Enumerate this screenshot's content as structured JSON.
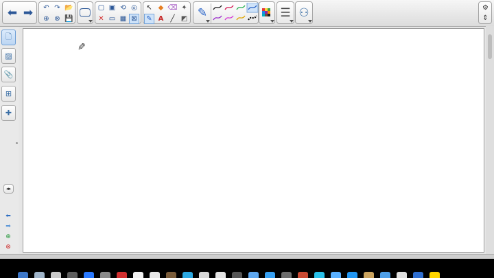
{
  "toolbar": {
    "nav": [
      {
        "name": "back-arrow-icon",
        "glyph": "⬅"
      },
      {
        "name": "forward-arrow-icon",
        "glyph": "➡"
      }
    ],
    "edit": [
      {
        "name": "undo-icon",
        "glyph": "↶"
      },
      {
        "name": "redo-icon",
        "glyph": "↷"
      },
      {
        "name": "open-folder-icon",
        "glyph": "📂"
      },
      {
        "name": "add-page-icon",
        "glyph": "⊕"
      },
      {
        "name": "delete-page-icon",
        "glyph": "⊗"
      },
      {
        "name": "save-icon",
        "glyph": "💾"
      }
    ],
    "screen": [
      {
        "name": "screen-shade-icon",
        "glyph": "🖵"
      }
    ],
    "insert": [
      {
        "name": "new-page-icon",
        "glyph": "▢"
      },
      {
        "name": "insert-picture-icon",
        "glyph": "▣"
      },
      {
        "name": "rotate-icon",
        "glyph": "⟲"
      },
      {
        "name": "screen-capture-icon",
        "glyph": "◎"
      },
      {
        "name": "delete-icon",
        "glyph": "✕"
      },
      {
        "name": "full-screen-icon",
        "glyph": "▭"
      },
      {
        "name": "table-icon",
        "glyph": "▦"
      },
      {
        "name": "document-camera-icon",
        "glyph": "⊠"
      }
    ],
    "tools": [
      {
        "name": "select-arrow-icon",
        "glyph": "↖"
      },
      {
        "name": "shapes-icon",
        "glyph": "◆"
      },
      {
        "name": "eraser-icon",
        "glyph": "⌫"
      },
      {
        "name": "magic-pen-icon",
        "glyph": "✦"
      },
      {
        "name": "creative-pen-icon",
        "glyph": "✎"
      },
      {
        "name": "text-tool-icon",
        "glyph": "A"
      },
      {
        "name": "line-tool-icon",
        "glyph": "╱"
      },
      {
        "name": "fill-icon",
        "glyph": "◩"
      }
    ],
    "pens": [
      {
        "name": "pen-tool-icon",
        "glyph": "✎"
      }
    ],
    "pen_colors": [
      "#1a1a1a",
      "#d4154f",
      "#22b14c",
      "#2a64c8",
      "#9b2ccd",
      "#d63ad6",
      "#e0a600",
      "#111111"
    ],
    "palette_colors": [
      "#e53935",
      "#fdd835",
      "#43a047",
      "#1e88e5",
      "#8e24aa",
      "#fb8c00",
      "#00acc1",
      "#6d4c41",
      "#212121"
    ],
    "properties": [
      {
        "name": "line-properties-icon",
        "glyph": "☰"
      }
    ],
    "addons": [
      {
        "name": "linked-objects-icon",
        "glyph": "⚇"
      }
    ],
    "right": [
      {
        "name": "settings-gear-icon",
        "glyph": "⚙"
      },
      {
        "name": "move-toolbar-icon",
        "glyph": "⇕"
      }
    ]
  },
  "sidebar": {
    "tabs": [
      {
        "name": "page-sorter-icon",
        "glyph": "🗋",
        "selected": true
      },
      {
        "name": "gallery-icon",
        "glyph": "▨",
        "selected": false
      },
      {
        "name": "attachments-icon",
        "glyph": "📎",
        "selected": false
      },
      {
        "name": "properties-icon",
        "glyph": "⊞",
        "selected": false
      },
      {
        "name": "addons-puzzle-icon",
        "glyph": "✚",
        "selected": false
      }
    ],
    "collapse": {
      "name": "collapse-sidebar-icon",
      "glyph": "◂▸"
    },
    "bottom": [
      {
        "name": "previous-page-icon",
        "glyph": "⬅",
        "color": "#2f6fc2"
      },
      {
        "name": "next-page-icon",
        "glyph": "➡",
        "color": "#5e98d8"
      },
      {
        "name": "add-blank-page-icon",
        "glyph": "⊕",
        "color": "#2e9b43"
      },
      {
        "name": "remove-page-icon",
        "glyph": "⊗",
        "color": "#cc2b2b"
      }
    ]
  },
  "canvas": {
    "cursor": {
      "name": "pen-cursor-icon",
      "glyph": "✎"
    }
  },
  "dock": {
    "colors": [
      "#3d77c8",
      "#9fb4c9",
      "#c9c9c9",
      "#5e5e5e",
      "#2979ff",
      "#8b8b8b",
      "#d12f2f",
      "#f2f2f2",
      "#e8e8e8",
      "#7a5c3a",
      "#2ba8e2",
      "#d9d9d9",
      "#e4e4e4",
      "#555555",
      "#5fa8f0",
      "#37a0f2",
      "#6d6d6d",
      "#c94a33",
      "#29c0e9",
      "#5ab0ff",
      "#2196f3",
      "#caa35e",
      "#4e9fe8",
      "#e0e0e0",
      "#2f6ecf",
      "#ffd400"
    ]
  }
}
